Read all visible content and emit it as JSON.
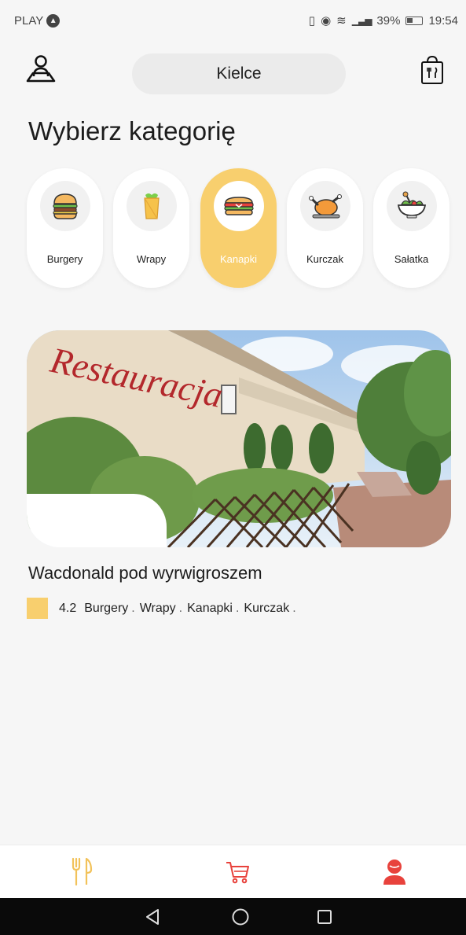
{
  "status_bar": {
    "carrier": "PLAY",
    "battery": "39%",
    "time": "19:54"
  },
  "header": {
    "city": "Kielce"
  },
  "page_title": "Wybierz kategorię",
  "categories": [
    {
      "label": "Burgery",
      "icon": "burger-icon",
      "active": false
    },
    {
      "label": "Wrapy",
      "icon": "wrap-icon",
      "active": false
    },
    {
      "label": "Kanapki",
      "icon": "sandwich-icon",
      "active": true
    },
    {
      "label": "Kurczak",
      "icon": "chicken-icon",
      "active": false
    },
    {
      "label": "Sałatka",
      "icon": "salad-icon",
      "active": false
    }
  ],
  "restaurant": {
    "sign_text": "Restauracja",
    "name": "Wacdonald pod wyrwigroszem",
    "rating": "4.2",
    "tags": [
      "Burgery",
      "Wrapy",
      "Kanapki",
      "Kurczak"
    ],
    "separator": "."
  },
  "bottom_nav": [
    {
      "name": "menu",
      "icon": "fork-knife-icon"
    },
    {
      "name": "cart",
      "icon": "cart-icon"
    },
    {
      "name": "profile",
      "icon": "user-icon"
    }
  ],
  "colors": {
    "accent": "#f8cf6e",
    "red": "#e8423c",
    "background": "#f6f6f6"
  }
}
